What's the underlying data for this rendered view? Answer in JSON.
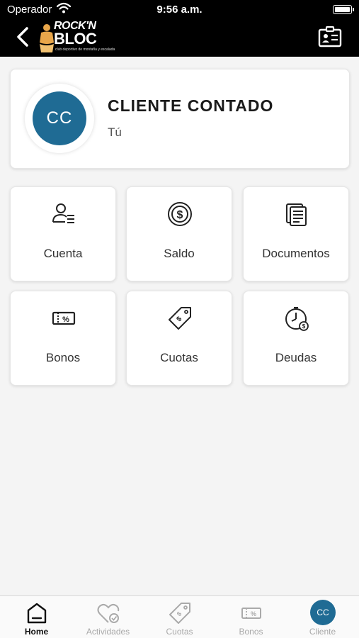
{
  "status_bar": {
    "carrier": "Operador",
    "time": "9:56 a.m."
  },
  "header": {
    "logo": {
      "line1": "ROCK'N",
      "line2": "BLOC",
      "tagline": "club deportivo de montaña y escalada"
    },
    "back_icon": "chevron-left-icon",
    "right_icon": "id-card-icon"
  },
  "profile": {
    "initials": "CC",
    "name": "CLIENTE CONTADO",
    "subtitle": "Tú",
    "avatar_color": "#1f6b94"
  },
  "tiles": [
    {
      "label": "Cuenta",
      "icon": "user-list-icon"
    },
    {
      "label": "Saldo",
      "icon": "coin-dollar-icon"
    },
    {
      "label": "Documentos",
      "icon": "documents-icon"
    },
    {
      "label": "Bonos",
      "icon": "voucher-percent-icon"
    },
    {
      "label": "Cuotas",
      "icon": "price-tag-icon"
    },
    {
      "label": "Deudas",
      "icon": "clock-debt-icon"
    }
  ],
  "tab_bar": {
    "items": [
      {
        "label": "Home",
        "active": true
      },
      {
        "label": "Actividades",
        "active": false
      },
      {
        "label": "Cuotas",
        "active": false
      },
      {
        "label": "Bonos",
        "active": false
      },
      {
        "label": "Cliente",
        "active": false,
        "initials": "CC"
      }
    ]
  }
}
